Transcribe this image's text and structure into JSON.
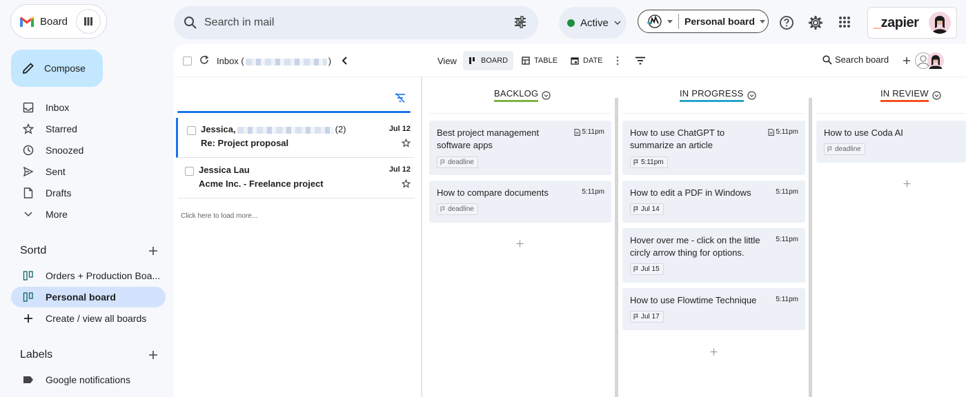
{
  "app": {
    "name": "Board",
    "search_placeholder": "Search in mail",
    "status": "Active",
    "board_selector": "Personal board",
    "brand": "zapier",
    "brand_prefix": "_"
  },
  "sidebar": {
    "compose": "Compose",
    "nav": [
      {
        "label": "Inbox",
        "icon": "inbox-icon"
      },
      {
        "label": "Starred",
        "icon": "star-icon"
      },
      {
        "label": "Snoozed",
        "icon": "clock-icon"
      },
      {
        "label": "Sent",
        "icon": "send-icon"
      },
      {
        "label": "Drafts",
        "icon": "draft-icon"
      },
      {
        "label": "More",
        "icon": "chevron-down-icon"
      }
    ],
    "sortd_title": "Sortd",
    "boards": [
      {
        "label": "Orders + Production Boa...",
        "active": false
      },
      {
        "label": "Personal board",
        "active": true
      },
      {
        "label": "Create / view all boards",
        "active": false
      }
    ],
    "labels_title": "Labels",
    "labels": [
      {
        "label": "Google notifications"
      }
    ]
  },
  "toolbar": {
    "inbox_label": "Inbox (",
    "inbox_close": ")",
    "view": "View",
    "views": [
      {
        "label": "BOARD",
        "active": true
      },
      {
        "label": "TABLE",
        "active": false
      },
      {
        "label": "DATE",
        "active": false
      }
    ],
    "search_board": "Search board"
  },
  "emails": [
    {
      "sender": "Jessica,",
      "count": "(2)",
      "subject": "Re: Project proposal",
      "date": "Jul 12",
      "selected": true
    },
    {
      "sender": "Jessica Lau",
      "count": "",
      "subject": "Acme Inc. - Freelance project",
      "date": "Jul 12",
      "selected": false
    }
  ],
  "load_more": "Click here to load more...",
  "board": {
    "columns": [
      {
        "title": "BACKLOG",
        "color": "#7cb342",
        "cards": [
          {
            "title": "Best project management software apps",
            "time": "5:11pm",
            "has_doc": true,
            "tag": "deadline"
          },
          {
            "title": "How to compare documents",
            "time": "5:11pm",
            "has_doc": false,
            "tag": "deadline"
          }
        ]
      },
      {
        "title": "IN PROGRESS",
        "color": "#26a5c9",
        "cards": [
          {
            "title": "How to use ChatGPT to summarize an article",
            "time": "5:11pm",
            "has_doc": true,
            "tag": "5:11pm"
          },
          {
            "title": "How to edit a PDF in Windows",
            "time": "5:11pm",
            "has_doc": false,
            "tag": "Jul 14"
          },
          {
            "title": "Hover over me - click on the little circly arrow thing for options.",
            "time": "5:11pm",
            "has_doc": false,
            "tag": "Jul 15"
          },
          {
            "title": "How to use Flowtime Technique",
            "time": "5:11pm",
            "has_doc": false,
            "tag": "Jul 17"
          }
        ]
      },
      {
        "title": "IN REVIEW",
        "color": "#f4511e",
        "cards": [
          {
            "title": "How to use Coda AI",
            "time": "",
            "has_doc": false,
            "tag": "deadline"
          }
        ]
      }
    ]
  }
}
